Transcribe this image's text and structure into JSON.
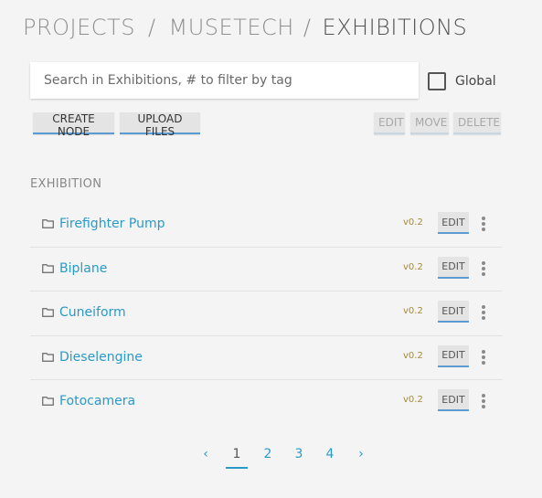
{
  "breadcrumb": {
    "items": [
      "PROJECTS",
      "MUSETECH",
      "EXHIBITIONS"
    ],
    "separator": "/"
  },
  "search": {
    "placeholder": "Search in Exhibitions, # to filter by tag",
    "value": ""
  },
  "global": {
    "label": "Global",
    "checked": false
  },
  "toolbar": {
    "create_node": "CREATE NODE",
    "upload_files": "UPLOAD FILES",
    "edit": "EDIT",
    "move": "MOVE",
    "delete": "DELETE"
  },
  "section": {
    "label": "EXHIBITION"
  },
  "rows": [
    {
      "icon": "folder-icon",
      "title": "Firefighter Pump",
      "version": "v0.2",
      "edit": "EDIT"
    },
    {
      "icon": "folder-icon",
      "title": "Biplane",
      "version": "v0.2",
      "edit": "EDIT"
    },
    {
      "icon": "folder-icon",
      "title": "Cuneiform",
      "version": "v0.2",
      "edit": "EDIT"
    },
    {
      "icon": "folder-icon",
      "title": "Dieselengine",
      "version": "v0.2",
      "edit": "EDIT"
    },
    {
      "icon": "folder-icon",
      "title": "Fotocamera",
      "version": "v0.2",
      "edit": "EDIT"
    }
  ],
  "pagination": {
    "prev": "‹",
    "pages": [
      "1",
      "2",
      "3",
      "4"
    ],
    "next": "›",
    "current": "1"
  },
  "colors": {
    "accent": "#2a9ac8",
    "button_underline": "#5b9bd1",
    "version": "#a38a3a",
    "background": "#f4f4f4"
  }
}
